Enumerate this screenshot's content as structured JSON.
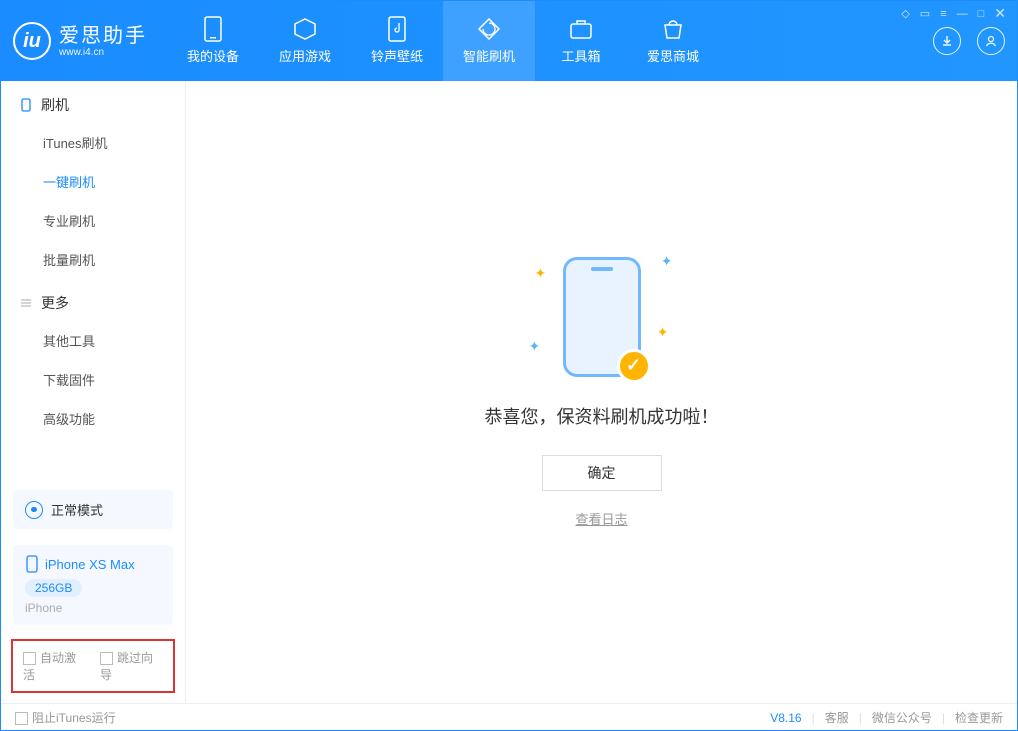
{
  "app": {
    "name": "爱思助手",
    "domain": "www.i4.cn"
  },
  "tabs": {
    "device": "我的设备",
    "apps": "应用游戏",
    "ringtones": "铃声壁纸",
    "flash": "智能刷机",
    "toolbox": "工具箱",
    "store": "爱思商城"
  },
  "sidebar": {
    "section_flash": "刷机",
    "items_flash": {
      "itunes": "iTunes刷机",
      "onekey": "一键刷机",
      "pro": "专业刷机",
      "batch": "批量刷机"
    },
    "section_more": "更多",
    "items_more": {
      "other": "其他工具",
      "firmware": "下载固件",
      "advanced": "高级功能"
    }
  },
  "mode": {
    "label": "正常模式"
  },
  "device": {
    "name": "iPhone XS Max",
    "capacity": "256GB",
    "type": "iPhone"
  },
  "options": {
    "auto_activate": "自动激活",
    "skip_guide": "跳过向导"
  },
  "main": {
    "message": "恭喜您，保资料刷机成功啦！",
    "ok": "确定",
    "log": "查看日志",
    "check": "✓"
  },
  "footer": {
    "block_itunes": "阻止iTunes运行",
    "version": "V8.16",
    "support": "客服",
    "wechat": "微信公众号",
    "update": "检查更新"
  }
}
